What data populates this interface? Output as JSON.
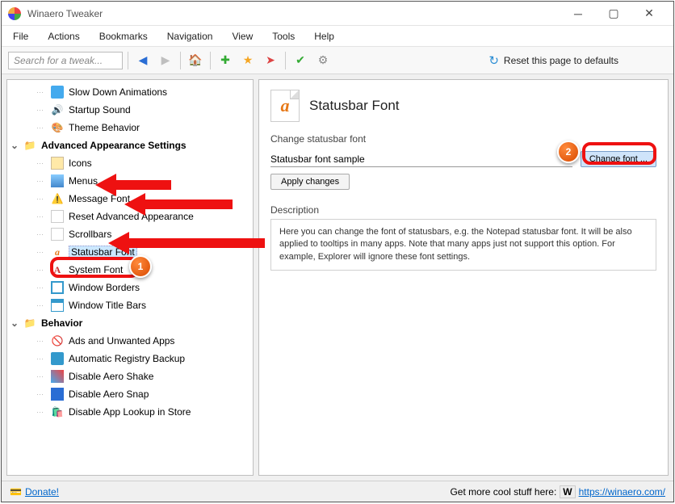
{
  "window": {
    "title": "Winaero Tweaker"
  },
  "menu": [
    "File",
    "Actions",
    "Bookmarks",
    "Navigation",
    "View",
    "Tools",
    "Help"
  ],
  "toolbar": {
    "search_placeholder": "Search for a tweak...",
    "reset_label": "Reset this page to defaults"
  },
  "sidebar": {
    "top_items": [
      {
        "label": "Slow Down Animations",
        "icon": "film"
      },
      {
        "label": "Startup Sound",
        "icon": "speaker"
      },
      {
        "label": "Theme Behavior",
        "icon": "palette"
      }
    ],
    "group1": {
      "label": "Advanced Appearance Settings",
      "items": [
        {
          "label": "Icons",
          "icon": "page"
        },
        {
          "label": "Menus",
          "icon": "menu"
        },
        {
          "label": "Message Font",
          "icon": "warn"
        },
        {
          "label": "Reset Advanced Appearance",
          "icon": "blank"
        },
        {
          "label": "Scrollbars",
          "icon": "blank"
        },
        {
          "label": "Statusbar Font",
          "icon": "afont",
          "selected": true
        },
        {
          "label": "System Font",
          "icon": "Afont"
        },
        {
          "label": "Window Borders",
          "icon": "border"
        },
        {
          "label": "Window Title Bars",
          "icon": "titlebar"
        }
      ]
    },
    "group2": {
      "label": "Behavior",
      "items": [
        {
          "label": "Ads and Unwanted Apps",
          "icon": "noads"
        },
        {
          "label": "Automatic Registry Backup",
          "icon": "registry"
        },
        {
          "label": "Disable Aero Shake",
          "icon": "shake"
        },
        {
          "label": "Disable Aero Snap",
          "icon": "snap"
        },
        {
          "label": "Disable App Lookup in Store",
          "icon": "store"
        }
      ]
    }
  },
  "main": {
    "title": "Statusbar Font",
    "subtitle": "Change statusbar font",
    "sample": "Statusbar font sample",
    "change_btn": "Change font ...",
    "apply_btn": "Apply changes",
    "desc_label": "Description",
    "description": "Here you can change the font of statusbars, e.g. the Notepad statusbar font. It will be also applied to tooltips in many apps. Note that many apps just not support this option. For example, Explorer will ignore these font settings."
  },
  "status": {
    "donate": "Donate!",
    "right_text": "Get more cool stuff here:",
    "url": "https://winaero.com/"
  },
  "annotations": {
    "n1": "1",
    "n2": "2"
  }
}
